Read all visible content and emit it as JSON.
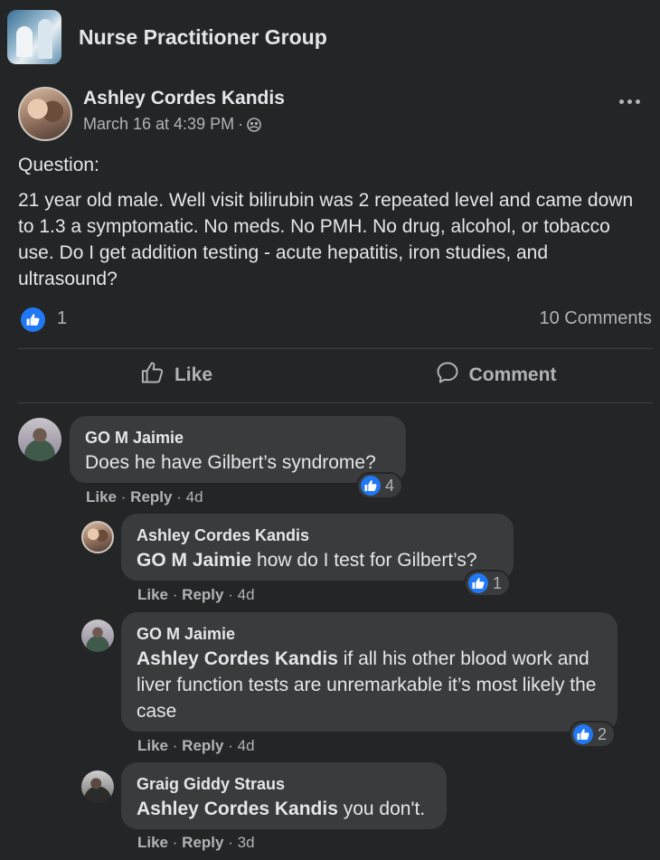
{
  "group": {
    "name": "Nurse Practitioner Group"
  },
  "post": {
    "author": "Ashley Cordes Kandis",
    "timestamp": "March 16 at 4:39 PM",
    "meta_sep": "·",
    "privacy_icon": "group-members-icon",
    "paragraphs": [
      "Question:",
      "21 year old male. Well visit bilirubin was 2 repeated level and came down to 1.3 a symptomatic. No meds.  No PMH.  No drug, alcohol, or tobacco use.  Do I get addition testing - acute hepatitis, iron studies, and ultrasound?"
    ],
    "reaction_count": "1",
    "comments_count": "10 Comments",
    "actions": {
      "like": "Like",
      "comment": "Comment"
    }
  },
  "comments": [
    {
      "name": "GO M Jaimie",
      "mention": "",
      "text": "Does he have Gilbert’s syndrome?",
      "reactions": "4",
      "like": "Like",
      "reply": "Reply",
      "sep": "·",
      "time": "4d"
    },
    {
      "name": "Ashley Cordes Kandis",
      "mention": "GO M Jaimie",
      "text": " how do I test for Gilbert’s?",
      "reactions": "1",
      "like": "Like",
      "reply": "Reply",
      "sep": "·",
      "time": "4d"
    },
    {
      "name": "GO M Jaimie",
      "mention": "Ashley Cordes Kandis",
      "text": " if all his other blood work and liver function tests are unremarkable it’s most likely the case",
      "reactions": "2",
      "like": "Like",
      "reply": "Reply",
      "sep": "·",
      "time": "4d"
    },
    {
      "name": "Graig Giddy Straus",
      "mention": "Ashley Cordes Kandis",
      "text": " you don't.",
      "reactions": "",
      "like": "Like",
      "reply": "Reply",
      "sep": "·",
      "time": "3d"
    }
  ],
  "colors": {
    "accent": "#2078f4",
    "bubble": "#3a3b3c",
    "background": "#242526",
    "secondary_text": "#b0b3b8"
  }
}
